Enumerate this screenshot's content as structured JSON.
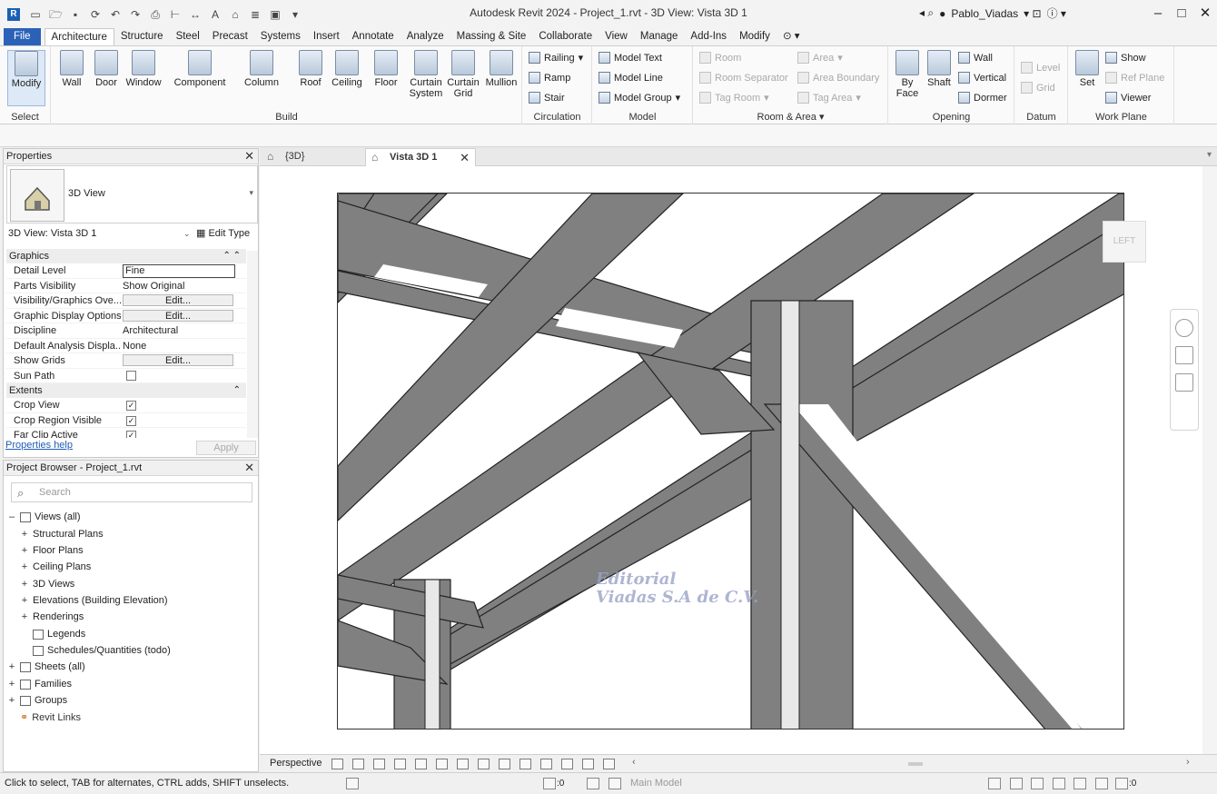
{
  "app": {
    "logo_letter": "R",
    "title": "Autodesk Revit 2024 - Project_1.rvt - 3D View: Vista 3D 1",
    "user": "Pablo_Viadas",
    "window_controls": [
      "–",
      "□",
      "✕"
    ]
  },
  "menu_tabs": [
    "File",
    "Architecture",
    "Structure",
    "Steel",
    "Precast",
    "Systems",
    "Insert",
    "Annotate",
    "Analyze",
    "Massing & Site",
    "Collaborate",
    "View",
    "Manage",
    "Add-Ins",
    "Modify"
  ],
  "ribbon": {
    "select": {
      "modify": "Modify",
      "panel": "Select"
    },
    "build": {
      "panel": "Build",
      "buttons": [
        "Wall",
        "Door",
        "Window",
        "Component",
        "Column",
        "Roof",
        "Ceiling",
        "Floor",
        "Curtain System",
        "Curtain Grid",
        "Mullion"
      ]
    },
    "circulation": {
      "panel": "Circulation",
      "items": [
        "Railing",
        "Ramp",
        "Stair"
      ]
    },
    "model": {
      "panel": "Model",
      "items": [
        "Model Text",
        "Model Line",
        "Model Group"
      ]
    },
    "room_area": {
      "panel": "Room & Area",
      "items": [
        "Room",
        "Room Separator",
        "Tag Room",
        "Area",
        "Area Boundary",
        "Tag Area"
      ]
    },
    "opening": {
      "panel": "Opening",
      "by_face": "By Face",
      "shaft": "Shaft",
      "items": [
        "Wall",
        "Vertical",
        "Dormer"
      ]
    },
    "datum": {
      "panel": "Datum",
      "items": [
        "Level",
        "Grid"
      ]
    },
    "work_plane": {
      "panel": "Work Plane",
      "set": "Set",
      "items": [
        "Show",
        "Ref Plane",
        "Viewer"
      ]
    }
  },
  "properties": {
    "title": "Properties",
    "type_name": "3D View",
    "view_selector": "3D View: Vista 3D 1",
    "edit_type": "Edit Type",
    "groups": [
      {
        "name": "Graphics",
        "rows": [
          {
            "name": "Detail Level",
            "value": "Fine"
          },
          {
            "name": "Parts Visibility",
            "value": "Show Original"
          },
          {
            "name": "Visibility/Graphics Ove...",
            "value": "Edit..."
          },
          {
            "name": "Graphic Display Options",
            "value": "Edit..."
          },
          {
            "name": "Discipline",
            "value": "Architectural"
          },
          {
            "name": "Default Analysis Displa...",
            "value": "None"
          },
          {
            "name": "Show Grids",
            "value": "Edit..."
          },
          {
            "name": "Sun Path",
            "value": ""
          }
        ]
      },
      {
        "name": "Extents",
        "rows": [
          {
            "name": "Crop View",
            "value": "✓"
          },
          {
            "name": "Crop Region Visible",
            "value": "✓"
          },
          {
            "name": "Far Clip Active",
            "value": "✓"
          }
        ]
      }
    ],
    "help_link": "Properties help",
    "apply": "Apply"
  },
  "project_browser": {
    "title": "Project Browser - Project_1.rvt",
    "search_placeholder": "Search",
    "tree": [
      {
        "label": "Views (all)",
        "toggle": "–"
      },
      {
        "label": "Structural Plans",
        "toggle": "+"
      },
      {
        "label": "Floor Plans",
        "toggle": "+"
      },
      {
        "label": "Ceiling Plans",
        "toggle": "+"
      },
      {
        "label": "3D Views",
        "toggle": "+"
      },
      {
        "label": "Elevations (Building Elevation)",
        "toggle": "+"
      },
      {
        "label": "Renderings",
        "toggle": "+"
      },
      {
        "label": "Legends",
        "toggle": ""
      },
      {
        "label": "Schedules/Quantities (todo)",
        "toggle": ""
      },
      {
        "label": "Sheets (all)",
        "toggle": "+"
      },
      {
        "label": "Families",
        "toggle": "+"
      },
      {
        "label": "Groups",
        "toggle": "+"
      },
      {
        "label": "Revit Links",
        "toggle": ""
      }
    ]
  },
  "view_tabs": [
    "{3D}",
    "Vista 3D 1"
  ],
  "viewcube_label": "LEFT",
  "watermark": [
    "Editorial",
    "Viadas S.A de C.V."
  ],
  "view_control_bar": {
    "projection": "Perspective"
  },
  "status_bar": {
    "hint": "Click to select, TAB for alternates, CTRL adds, SHIFT unselects.",
    "worksets": ":0",
    "model": "Main Model",
    "filter_count": ":0"
  }
}
